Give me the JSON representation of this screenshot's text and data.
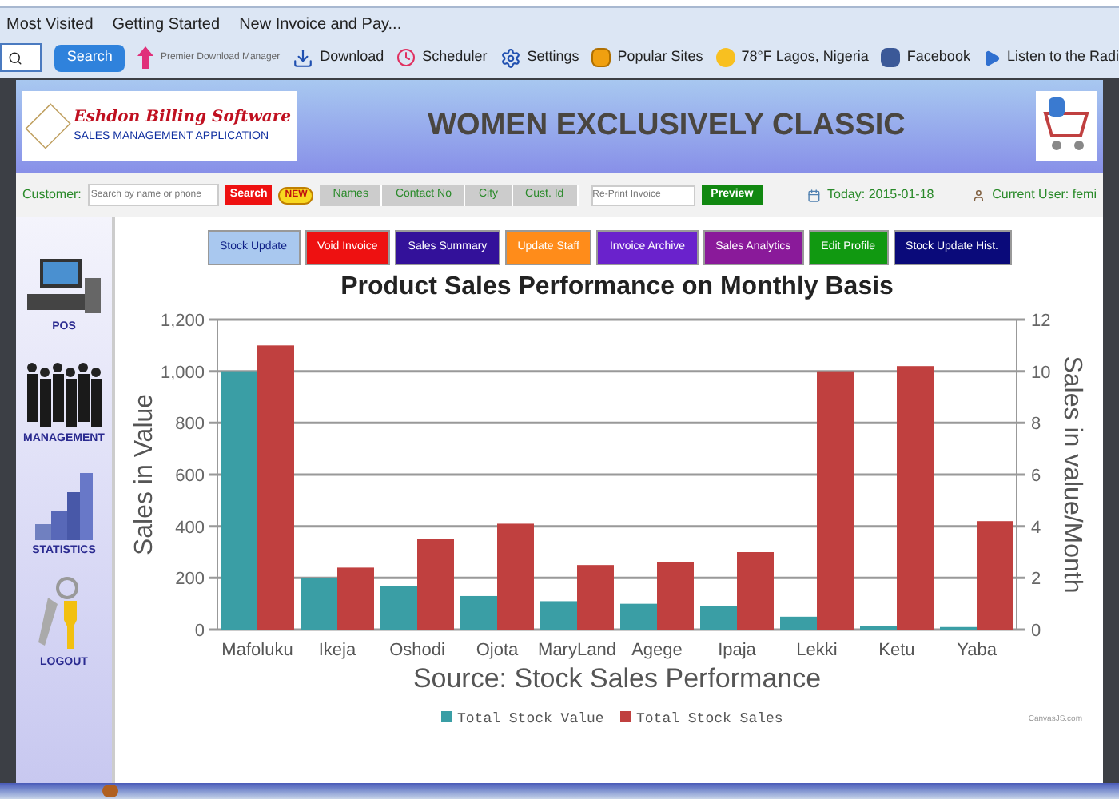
{
  "browser": {
    "bookmarks": [
      "Most Visited",
      "Getting Started",
      "New Invoice and Pay..."
    ],
    "search_button": "Search",
    "toolbar": [
      {
        "kind": "pdm",
        "label": "Premier Download Manager"
      },
      {
        "kind": "download",
        "label": "Download"
      },
      {
        "kind": "scheduler",
        "label": "Scheduler"
      },
      {
        "kind": "settings",
        "label": "Settings"
      },
      {
        "kind": "popular",
        "label": "Popular Sites"
      },
      {
        "kind": "weather",
        "label": "78°F Lagos, Nigeria"
      },
      {
        "kind": "facebook",
        "label": "Facebook"
      },
      {
        "kind": "radio",
        "label": "Listen to the Radi"
      }
    ]
  },
  "header": {
    "logo_title": "Eshdon Billing Software",
    "logo_subtitle": "SALES MANAGEMENT APPLICATION",
    "title": "WOMEN EXCLUSIVELY CLASSIC"
  },
  "customer_bar": {
    "label": "Customer:",
    "placeholder": "Search by name or phone",
    "search_button": "Search",
    "new_badge": "NEW",
    "columns": [
      "Names",
      "Contact No",
      "City",
      "Cust. Id"
    ],
    "reprint_placeholder": "Re-Print Invoice",
    "preview_button": "Preview",
    "today": "Today: 2015-01-18",
    "current_user": "Current User: femi"
  },
  "sidebar": {
    "items": [
      {
        "kind": "pos",
        "label": "POS"
      },
      {
        "kind": "management",
        "label": "MANAGEMENT"
      },
      {
        "kind": "statistics",
        "label": "STATISTICS"
      },
      {
        "kind": "logout",
        "label": "LOGOUT"
      }
    ]
  },
  "main": {
    "buttons": [
      {
        "label": "Stock Update",
        "color": "#a9c8ef"
      },
      {
        "label": "Void Invoice",
        "color": "#ee1111"
      },
      {
        "label": "Sales Summary",
        "color": "#33119a"
      },
      {
        "label": "Update Staff",
        "color": "#ff8c1a"
      },
      {
        "label": "Invoice Archive",
        "color": "#6a22cc"
      },
      {
        "label": "Sales Analytics",
        "color": "#8a1a9a"
      },
      {
        "label": "Edit Profile",
        "color": "#119911"
      },
      {
        "label": "Stock Update Hist.",
        "color": "#0a0a7a"
      }
    ],
    "chart_data": {
      "type": "bar",
      "title": "Product Sales Performance on Monthly Basis",
      "xlabel": "Source: Stock Sales Performance",
      "ylabel": "Sales in Value",
      "y2label": "Sales in value/Month",
      "categories": [
        "Mafoluku",
        "Ikeja",
        "Oshodi",
        "Ojota",
        "MaryLand",
        "Agege",
        "Ipaja",
        "Lekki",
        "Ketu",
        "Yaba"
      ],
      "series": [
        {
          "name": "Total Stock Value",
          "color": "#3a9ea5",
          "values": [
            1000,
            200,
            170,
            130,
            110,
            100,
            90,
            50,
            15,
            10
          ]
        },
        {
          "name": "Total Stock Sales",
          "color": "#c0403f",
          "axis": "y2",
          "values": [
            11,
            2.4,
            3.5,
            4.1,
            2.5,
            2.6,
            3,
            10,
            10.2,
            4.2
          ]
        }
      ],
      "stacked": false,
      "grid": true,
      "legend": "bottom",
      "ylim": [
        0,
        1200
      ],
      "yticks": [
        0,
        {
          "value": 200,
          "label": "200"
        },
        {
          "value": 400,
          "label": "400"
        },
        {
          "value": 600,
          "label": "600"
        },
        {
          "value": 800,
          "label": "800"
        },
        {
          "value": 1000,
          "label": "1,000"
        },
        {
          "value": 1200,
          "label": "1,200"
        }
      ],
      "y2lim": [
        0,
        12
      ],
      "y2ticks": [
        0,
        2,
        4,
        6,
        8,
        10,
        12
      ]
    },
    "credit": "CanvasJS.com"
  }
}
